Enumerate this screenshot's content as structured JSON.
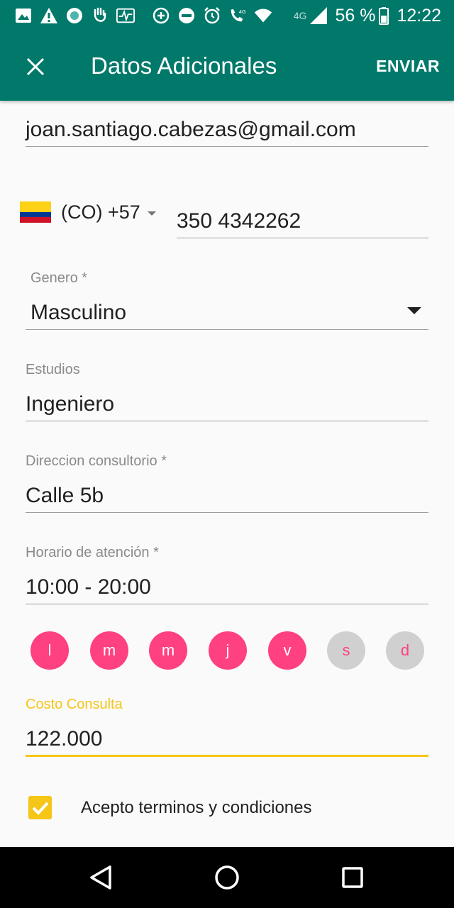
{
  "status_bar": {
    "battery": "56 %",
    "time": "12:22",
    "lte_label_1": "4G",
    "lte_label_2": "4G",
    "left_icons": [
      "image-icon",
      "warning-icon",
      "circle-notification-icon",
      "hand-icon",
      "pulse-icon"
    ],
    "mid_icons": [
      "data-saver-icon",
      "do-not-disturb-icon",
      "alarm-icon",
      "volte-call-icon",
      "wifi-icon",
      "cell-signal-icon",
      "battery-icon"
    ]
  },
  "app_bar": {
    "title": "Datos Adicionales",
    "action": "ENVIAR",
    "background": "#00796b"
  },
  "form": {
    "email": "joan.santiago.cabezas@gmail.com",
    "country_code": "(CO) +57",
    "phone": "350 4342262",
    "gender_label": "Genero *",
    "gender_value": "Masculino",
    "studies_label": "Estudios",
    "studies_value": "Ingeniero",
    "address_label": "Direccion consultorio *",
    "address_value": "Calle 5b",
    "schedule_label": "Horario de atención *",
    "schedule_value": "10:00 - 20:00",
    "days": [
      {
        "label": "l",
        "selected": true
      },
      {
        "label": "m",
        "selected": true
      },
      {
        "label": "m",
        "selected": true
      },
      {
        "label": "j",
        "selected": true
      },
      {
        "label": "v",
        "selected": true
      },
      {
        "label": "s",
        "selected": false
      },
      {
        "label": "d",
        "selected": false
      }
    ],
    "cost_label": "Costo Consulta",
    "cost_value": "122.000",
    "terms_label": "Acepto terminos y condiciones",
    "terms_checked": true
  },
  "colors": {
    "primary": "#00796b",
    "accent": "#ff4081",
    "focus": "#f5c518",
    "day_off": "#d0d0d0"
  }
}
